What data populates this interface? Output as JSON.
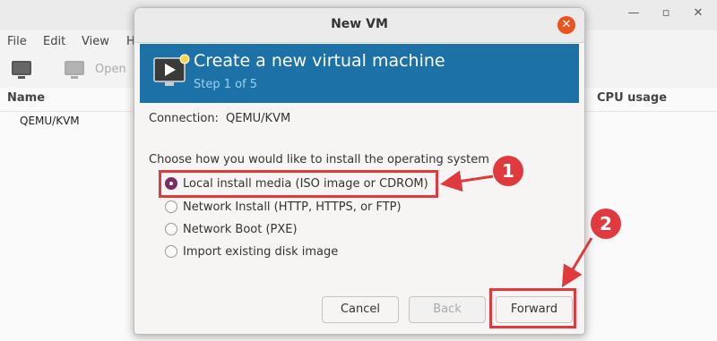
{
  "background_window": {
    "menu": [
      "File",
      "Edit",
      "View",
      "H"
    ],
    "toolbar": {
      "open_label": "Open"
    },
    "columns": {
      "name": "Name",
      "cpu": "CPU usage"
    },
    "connections": [
      "QEMU/KVM"
    ]
  },
  "dialog": {
    "title": "New VM",
    "banner": {
      "title": "Create a new virtual machine",
      "step": "Step 1 of 5"
    },
    "connection": {
      "label": "Connection:",
      "value": "QEMU/KVM"
    },
    "prompt": "Choose how you would like to install the operating system",
    "options": [
      {
        "label": "Local install media (ISO image or CDROM)",
        "selected": true
      },
      {
        "label": "Network Install (HTTP, HTTPS, or FTP)",
        "selected": false
      },
      {
        "label": "Network Boot (PXE)",
        "selected": false
      },
      {
        "label": "Import existing disk image",
        "selected": false
      }
    ],
    "buttons": {
      "cancel": "Cancel",
      "back": "Back",
      "forward": "Forward"
    }
  },
  "annotations": {
    "badge1": "1",
    "badge2": "2"
  },
  "colors": {
    "accent": "#e0393e",
    "banner": "#1c71a6",
    "radio_selected": "#7b2e5d",
    "close": "#e95420"
  }
}
